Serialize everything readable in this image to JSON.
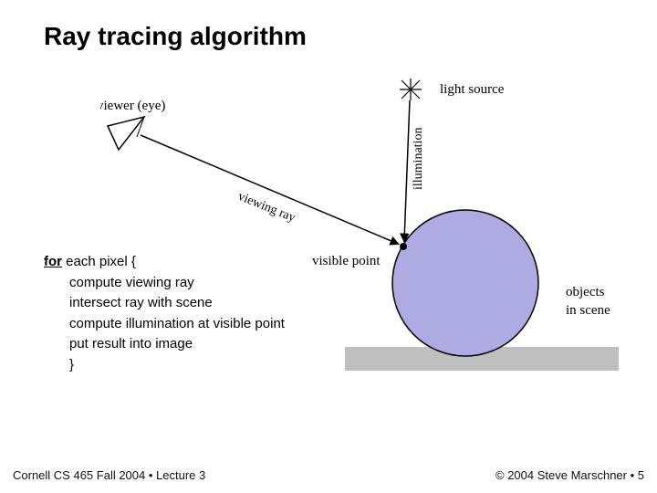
{
  "title": "Ray tracing algorithm",
  "labels": {
    "viewer": "viewer (eye)",
    "viewing_ray": "viewing ray",
    "light_source": "light source",
    "illumination": "illumination",
    "visible_point": "visible point",
    "objects_1": "objects",
    "objects_2": "in scene"
  },
  "algorithm": {
    "for_kw": "for",
    "for_rest": " each pixel {",
    "l1": "compute viewing ray",
    "l2": "intersect ray with scene",
    "l3": "compute illumination at visible point",
    "l4": "put result into image",
    "l5": "}"
  },
  "footer": {
    "left": "Cornell CS 465 Fall 2004 • Lecture 3",
    "right": "© 2004 Steve Marschner • 5"
  },
  "colors": {
    "sphere_fill": "#aeabe2",
    "ground_fill": "#bfbfbf"
  }
}
